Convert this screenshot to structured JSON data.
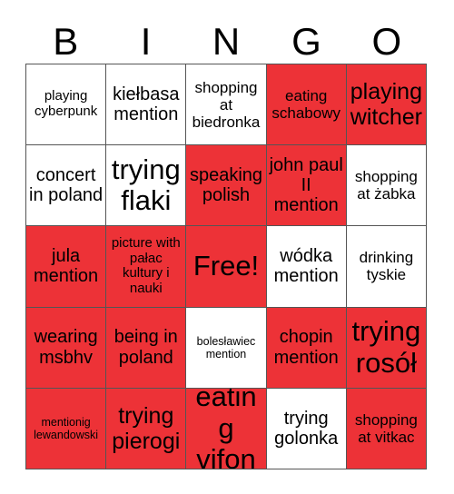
{
  "card": {
    "title": "BINGO",
    "headers": [
      "B",
      "I",
      "N",
      "G",
      "O"
    ],
    "colors": {
      "marked": "#ed3237",
      "unmarked": "#ffffff",
      "grid_line": "#555555",
      "text": "#000000"
    },
    "free_space": "Free!",
    "rows": [
      [
        {
          "label": "playing cyberpunk",
          "marked": false,
          "size": "sm"
        },
        {
          "label": "kiełbasa mention",
          "marked": false,
          "size": "lg"
        },
        {
          "label": "shopping at biedronka",
          "marked": false,
          "size": "md"
        },
        {
          "label": "eating schabowy",
          "marked": true,
          "size": "md"
        },
        {
          "label": "playing witcher",
          "marked": true,
          "size": "xl"
        }
      ],
      [
        {
          "label": "concert in poland",
          "marked": false,
          "size": "lg"
        },
        {
          "label": "trying flaki",
          "marked": false,
          "size": "xxl"
        },
        {
          "label": "speaking polish",
          "marked": true,
          "size": "lg"
        },
        {
          "label": "john paul II mention",
          "marked": true,
          "size": "lg"
        },
        {
          "label": "shopping at żabka",
          "marked": false,
          "size": "md"
        }
      ],
      [
        {
          "label": "jula mention",
          "marked": true,
          "size": "lg"
        },
        {
          "label": "picture with pałac kultury i nauki",
          "marked": true,
          "size": "sm"
        },
        {
          "label": "Free!",
          "marked": true,
          "size": "xxl"
        },
        {
          "label": "wódka mention",
          "marked": false,
          "size": "lg"
        },
        {
          "label": "drinking tyskie",
          "marked": false,
          "size": "md"
        }
      ],
      [
        {
          "label": "wearing msbhv",
          "marked": true,
          "size": "lg"
        },
        {
          "label": "being in poland",
          "marked": true,
          "size": "lg"
        },
        {
          "label": "bolesławiec mention",
          "marked": false,
          "size": "xs"
        },
        {
          "label": "chopin mention",
          "marked": true,
          "size": "lg"
        },
        {
          "label": "trying rosół",
          "marked": true,
          "size": "xxl"
        }
      ],
      [
        {
          "label": "mentionig lewandowski",
          "marked": true,
          "size": "xs"
        },
        {
          "label": "trying pierogi",
          "marked": true,
          "size": "xl"
        },
        {
          "label": "eating vifon",
          "marked": true,
          "size": "xxl"
        },
        {
          "label": "trying golonka",
          "marked": false,
          "size": "lg"
        },
        {
          "label": "shopping at vitkac",
          "marked": true,
          "size": "md"
        }
      ]
    ]
  }
}
